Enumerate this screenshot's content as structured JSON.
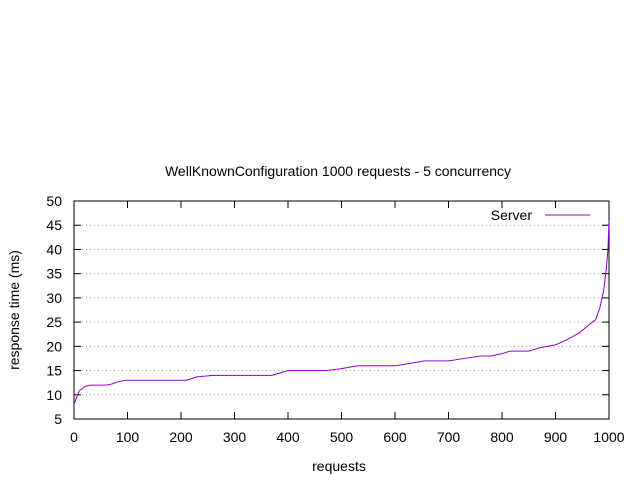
{
  "chart_data": {
    "type": "line",
    "title": "WellKnownConfiguration 1000 requests - 5 concurrency",
    "xlabel": "requests",
    "ylabel": "response time (ms)",
    "xlim": [
      0,
      1000
    ],
    "ylim": [
      5,
      50
    ],
    "xticks": [
      0,
      100,
      200,
      300,
      400,
      500,
      600,
      700,
      800,
      900,
      1000
    ],
    "yticks": [
      5,
      10,
      15,
      20,
      25,
      30,
      35,
      40,
      45,
      50
    ],
    "grid": "horizontal-dotted",
    "legend": "top-right",
    "series": [
      {
        "name": "Server",
        "color": "#9400d3",
        "points": [
          [
            0,
            8
          ],
          [
            5,
            9.5
          ],
          [
            10,
            10.8
          ],
          [
            20,
            11.7
          ],
          [
            30,
            12
          ],
          [
            40,
            12
          ],
          [
            60,
            12
          ],
          [
            70,
            12.2
          ],
          [
            80,
            12.6
          ],
          [
            95,
            13
          ],
          [
            110,
            13
          ],
          [
            150,
            13
          ],
          [
            210,
            13
          ],
          [
            230,
            13.7
          ],
          [
            260,
            14
          ],
          [
            300,
            14
          ],
          [
            370,
            14
          ],
          [
            385,
            14.5
          ],
          [
            400,
            15
          ],
          [
            470,
            15
          ],
          [
            500,
            15.4
          ],
          [
            530,
            16
          ],
          [
            600,
            16
          ],
          [
            630,
            16.5
          ],
          [
            655,
            17
          ],
          [
            700,
            17
          ],
          [
            730,
            17.5
          ],
          [
            760,
            18
          ],
          [
            780,
            18
          ],
          [
            800,
            18.5
          ],
          [
            815,
            19
          ],
          [
            850,
            19
          ],
          [
            870,
            19.7
          ],
          [
            900,
            20.3
          ],
          [
            920,
            21.3
          ],
          [
            945,
            22.8
          ],
          [
            960,
            24.2
          ],
          [
            975,
            25.5
          ],
          [
            983,
            28
          ],
          [
            990,
            31.5
          ],
          [
            995,
            36
          ],
          [
            998,
            40
          ],
          [
            1000,
            46
          ]
        ]
      }
    ]
  }
}
